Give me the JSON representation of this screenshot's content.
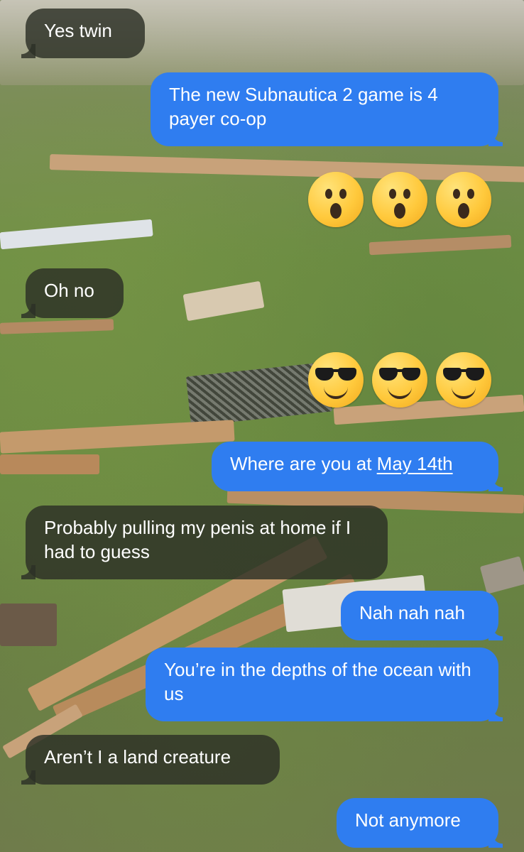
{
  "conversation": {
    "messages": [
      {
        "id": "m1",
        "direction": "received",
        "text": "Yes twin"
      },
      {
        "id": "m2",
        "direction": "sent",
        "text": "The new Subnautica 2 game is 4 payer co-op"
      },
      {
        "id": "m3",
        "direction": "sent",
        "type": "emoji",
        "icons": [
          "astonished-face-icon",
          "astonished-face-icon",
          "astonished-face-icon"
        ]
      },
      {
        "id": "m4",
        "direction": "received",
        "text": "Oh no"
      },
      {
        "id": "m5",
        "direction": "sent",
        "type": "emoji",
        "icons": [
          "sunglasses-face-icon",
          "sunglasses-face-icon",
          "sunglasses-face-icon"
        ]
      },
      {
        "id": "m6",
        "direction": "sent",
        "text_prefix": "Where are you at ",
        "link_text": "May 14th"
      },
      {
        "id": "m7",
        "direction": "received",
        "text": "Probably pulling my penis at home if I had to guess"
      },
      {
        "id": "m8",
        "direction": "sent",
        "text": "Nah nah nah"
      },
      {
        "id": "m9",
        "direction": "sent",
        "text": "You’re in the depths of the ocean with us"
      },
      {
        "id": "m10",
        "direction": "received",
        "text": "Aren’t I a land creature"
      },
      {
        "id": "m11",
        "direction": "sent",
        "text": "Not anymore"
      }
    ]
  },
  "colors": {
    "sent_bubble": "#2f7df0",
    "received_bubble": "rgba(44,48,38,0.82)",
    "text": "#ffffff"
  },
  "background": {
    "description_icon": "grass-debris-background"
  }
}
